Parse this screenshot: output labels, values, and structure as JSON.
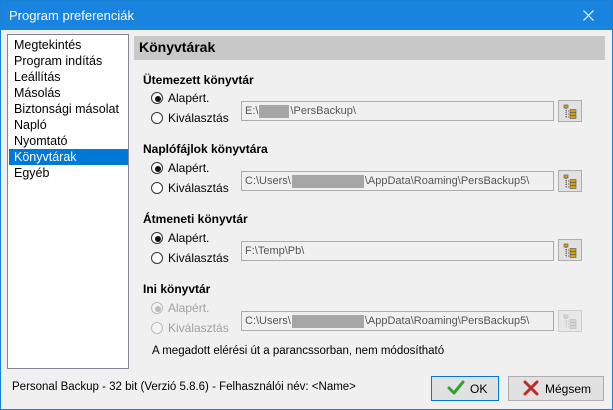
{
  "window": {
    "title": "Program preferenciák"
  },
  "nav": {
    "items": [
      "Megtekintés",
      "Program indítás",
      "Leállítás",
      "Másolás",
      "Biztonsági másolat",
      "Napló",
      "Nyomtató",
      "Könyvtárak",
      "Egyéb"
    ],
    "selected": "Könyvtárak"
  },
  "section": {
    "title": "Könyvtárak"
  },
  "groups": [
    {
      "title": "Ütemezett könyvtár",
      "default_label": "Alapért.",
      "custom_label": "Kiválasztás",
      "path_prefix": "E:\\",
      "path_suffix": "\\PersBackup\\",
      "selected": "default",
      "enabled": true
    },
    {
      "title": "Naplófájlok könyvtára",
      "default_label": "Alapért.",
      "custom_label": "Kiválasztás",
      "path_prefix": "C:\\Users\\",
      "path_suffix": "\\AppData\\Roaming\\PersBackup5\\",
      "selected": "default",
      "enabled": true
    },
    {
      "title": "Átmeneti könyvtár",
      "default_label": "Alapért.",
      "custom_label": "Kiválasztás",
      "path_prefix": "F:\\Temp\\Pb\\",
      "path_suffix": "",
      "selected": "default",
      "enabled": true
    },
    {
      "title": "Ini könyvtár",
      "default_label": "Alapért.",
      "custom_label": "Kiválasztás",
      "path_prefix": "C:\\Users\\",
      "path_suffix": "\\AppData\\Roaming\\PersBackup5\\",
      "selected": "default",
      "enabled": false
    }
  ],
  "note": "A megadott elérési út a parancssorban, nem módosítható",
  "status": "Personal Backup - 32 bit (Verzió 5.8.6) - Felhasználói név: <Name>",
  "buttons": {
    "ok": "OK",
    "cancel": "Mégsem"
  },
  "colors": {
    "titlebar": "#1983e0",
    "selection": "#0078d7",
    "header": "#c8c8c8",
    "ok_check": "#2fa22f",
    "cancel_x": "#c0282a"
  },
  "icons": {
    "browse": "folder-tree-icon",
    "ok": "checkmark-icon",
    "cancel": "x-icon",
    "close": "close-icon"
  }
}
